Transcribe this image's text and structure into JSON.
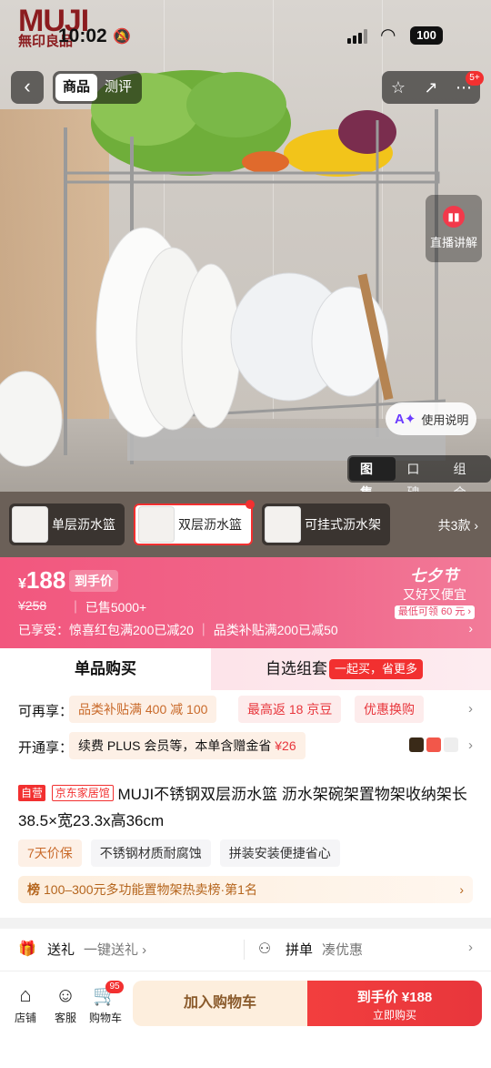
{
  "brand": {
    "logo_top": "MUJI",
    "logo_bottom": "無印良品"
  },
  "status_bar": {
    "time": "10:02",
    "battery": "100"
  },
  "nav": {
    "back": "‹",
    "tabs": [
      {
        "label": "商品",
        "active": true
      },
      {
        "label": "测评",
        "active": false
      }
    ],
    "badge": "5+"
  },
  "hero": {
    "live_label": "直播讲解",
    "usage_label": "使用说明",
    "media_tabs": [
      {
        "label": "图集",
        "active": true
      },
      {
        "label": "口碑"
      },
      {
        "label": "组合"
      }
    ]
  },
  "variants": {
    "items": [
      {
        "label": "单层沥水篮",
        "active": false
      },
      {
        "label": "双层沥水篮",
        "active": true
      },
      {
        "label": "可挂式沥水架",
        "active": false
      }
    ],
    "count_label": "共3款 ›"
  },
  "price": {
    "currency": "¥",
    "value": "188",
    "tag": "到手价",
    "original": "¥258",
    "sold": "已售5000+",
    "enjoy": "已享受：惊喜红包满200已减20 ｜ 品类补贴满200已减50",
    "festival_title": "七夕节",
    "festival_sub": "又好又便宜",
    "festival_note": "最低可领 60 元 ›"
  },
  "buy_tabs": {
    "single": "单品购买",
    "combo": "自选组套",
    "combo_badge": "一起买，省更多"
  },
  "benefits": {
    "label": "可再享：",
    "chips": [
      "品类补贴满 400 减 100",
      "最高返 18 京豆",
      "优惠换购"
    ]
  },
  "plus": {
    "label": "开通享：",
    "text": "续费 PLUS 会员等，本单含赠金省",
    "amount": "¥26"
  },
  "product": {
    "tag_self": "自营",
    "tag_store": "京东家居馆",
    "title": "MUJI不锈钢双层沥水篮 沥水架碗架置物架收纳架长38.5×宽23.3x高36cm",
    "props": [
      "7天价保",
      "不锈钢材质耐腐蚀",
      "拼装安装便捷省心"
    ],
    "rank_icon": "榜",
    "rank": "100–300元多功能置物架热卖榜·第1名"
  },
  "service": {
    "gift_label": "送礼",
    "gift_desc": "一键送礼 ›",
    "group_label": "拼单",
    "group_desc": "凑优惠"
  },
  "bottom_bar": {
    "store": "店铺",
    "service": "客服",
    "cart": "购物车",
    "cart_count": "95",
    "add_cart": "加入购物车",
    "buy_price": "到手价 ¥188",
    "buy_action": "立即购买"
  },
  "colors": {
    "accent": "#f23030",
    "banner_pink": "#f0668a",
    "gold": "#c96a2a"
  }
}
